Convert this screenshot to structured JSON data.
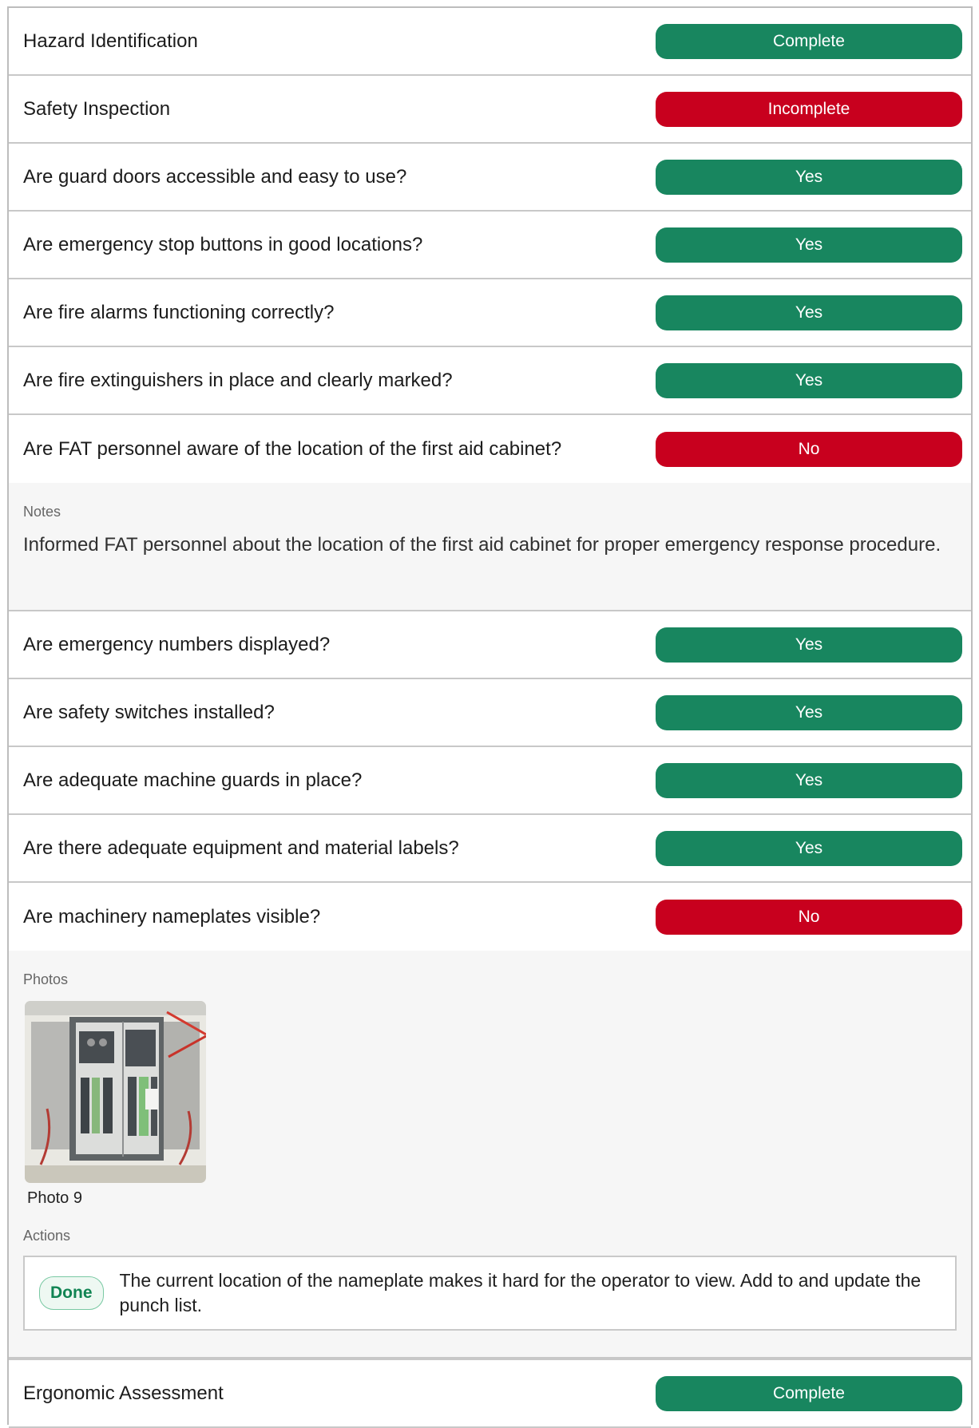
{
  "rows": [
    {
      "label": "Hazard Identification",
      "status": "Complete",
      "color": "#18865f"
    },
    {
      "label": "Safety Inspection",
      "status": "Incomplete",
      "color": "#c8001e"
    },
    {
      "label": "Are guard doors accessible and easy to use?",
      "status": "Yes",
      "color": "#18865f"
    },
    {
      "label": "Are emergency stop buttons in good locations?",
      "status": "Yes",
      "color": "#18865f"
    },
    {
      "label": "Are fire alarms functioning correctly?",
      "status": "Yes",
      "color": "#18865f"
    },
    {
      "label": "Are fire extinguishers in place and clearly marked?",
      "status": "Yes",
      "color": "#18865f"
    },
    {
      "label": "Are FAT personnel aware of the location of the first aid cabinet?",
      "status": "No",
      "color": "#c8001e"
    },
    {
      "label": "Are emergency numbers displayed?",
      "status": "Yes",
      "color": "#18865f"
    },
    {
      "label": "Are safety switches installed?",
      "status": "Yes",
      "color": "#18865f"
    },
    {
      "label": "Are adequate machine guards in place?",
      "status": "Yes",
      "color": "#18865f"
    },
    {
      "label": "Are there adequate equipment and material labels?",
      "status": "Yes",
      "color": "#18865f"
    },
    {
      "label": "Are machinery nameplates visible?",
      "status": "No",
      "color": "#c8001e"
    },
    {
      "label": "Ergonomic Assessment",
      "status": "Complete",
      "color": "#18865f"
    }
  ],
  "notes": {
    "title": "Notes",
    "text": "Informed FAT personnel about the location of the first aid cabinet for proper emergency response procedure."
  },
  "photos": {
    "title": "Photos",
    "caption": "Photo 9"
  },
  "actions": {
    "title": "Actions",
    "status": "Done",
    "text": "The current location of the nameplate makes it hard for the operator to view. Add to and update the punch list."
  }
}
